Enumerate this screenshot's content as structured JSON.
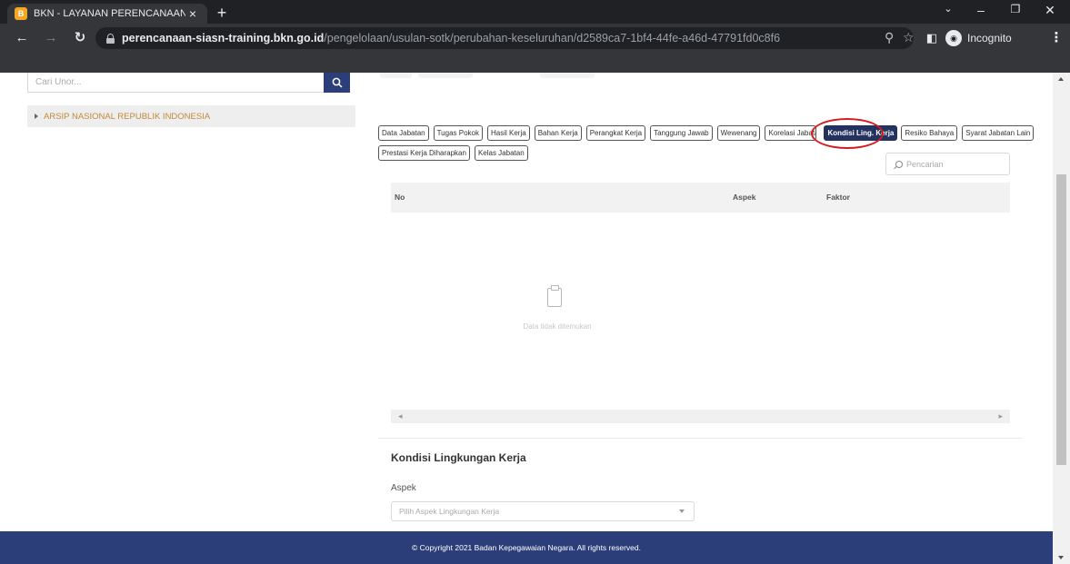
{
  "browser": {
    "tab_title": "BKN - LAYANAN PERENCANAAN",
    "url_host": "perencanaan-siasn-training.bkn.go.id",
    "url_path": "/pengelolaan/usulan-sotk/perubahan-keseluruhan/d2589ca7-1bf4-44fe-a46d-47791fd0c8f6",
    "profile_label": "Incognito"
  },
  "sidebar": {
    "search_placeholder": "Cari Unor...",
    "tree_items": [
      {
        "label": "ARSIP NASIONAL REPUBLIK INDONESIA"
      }
    ]
  },
  "jabatan_tabs": {
    "row1": [
      "Data Jabatan",
      "Tugas Pokok",
      "Hasil Kerja",
      "Bahan Kerja",
      "Perangkat Kerja",
      "Tanggung Jawab",
      "Wewenang",
      "Korelasi Jabatan",
      "Kondisi Ling. Kerja",
      "Resiko Bahaya",
      "Syarat Jabatan Lain"
    ],
    "row2": [
      "Prestasi Kerja Diharapkan",
      "Kelas Jabatan"
    ],
    "active": "Kondisi Ling. Kerja"
  },
  "table": {
    "search_placeholder": "Pencarian",
    "columns": [
      "No",
      "Aspek",
      "Faktor"
    ],
    "rows": [],
    "empty_text": "Data tidak ditemukan"
  },
  "form": {
    "section_title": "Kondisi Lingkungan Kerja",
    "aspek_label": "Aspek",
    "aspek_placeholder": "Pilih Aspek Lingkungan Kerja"
  },
  "footer": {
    "copyright": "© Copyright 2021 Badan Kepegawaian Negara. All rights reserved."
  },
  "colors": {
    "primary": "#2c3e7a",
    "active_tab": "#23325e",
    "highlight_circle": "#d71920",
    "tree_label": "#c08a3a"
  }
}
